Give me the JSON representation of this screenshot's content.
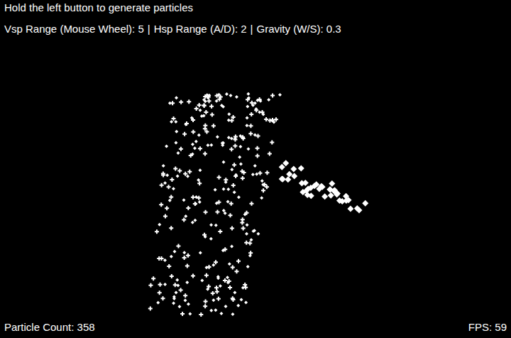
{
  "instructions": "Hold the left button to generate particles",
  "settings": {
    "items": [
      "Vsp Range (Mouse Wheel): 5",
      "Hsp Range (A/D): 2",
      "Gravity (W/S): 0.3"
    ],
    "separator": "|"
  },
  "status_bar": {
    "particle_count": "Particle Count: 358",
    "fps": "FPS: 59"
  }
}
